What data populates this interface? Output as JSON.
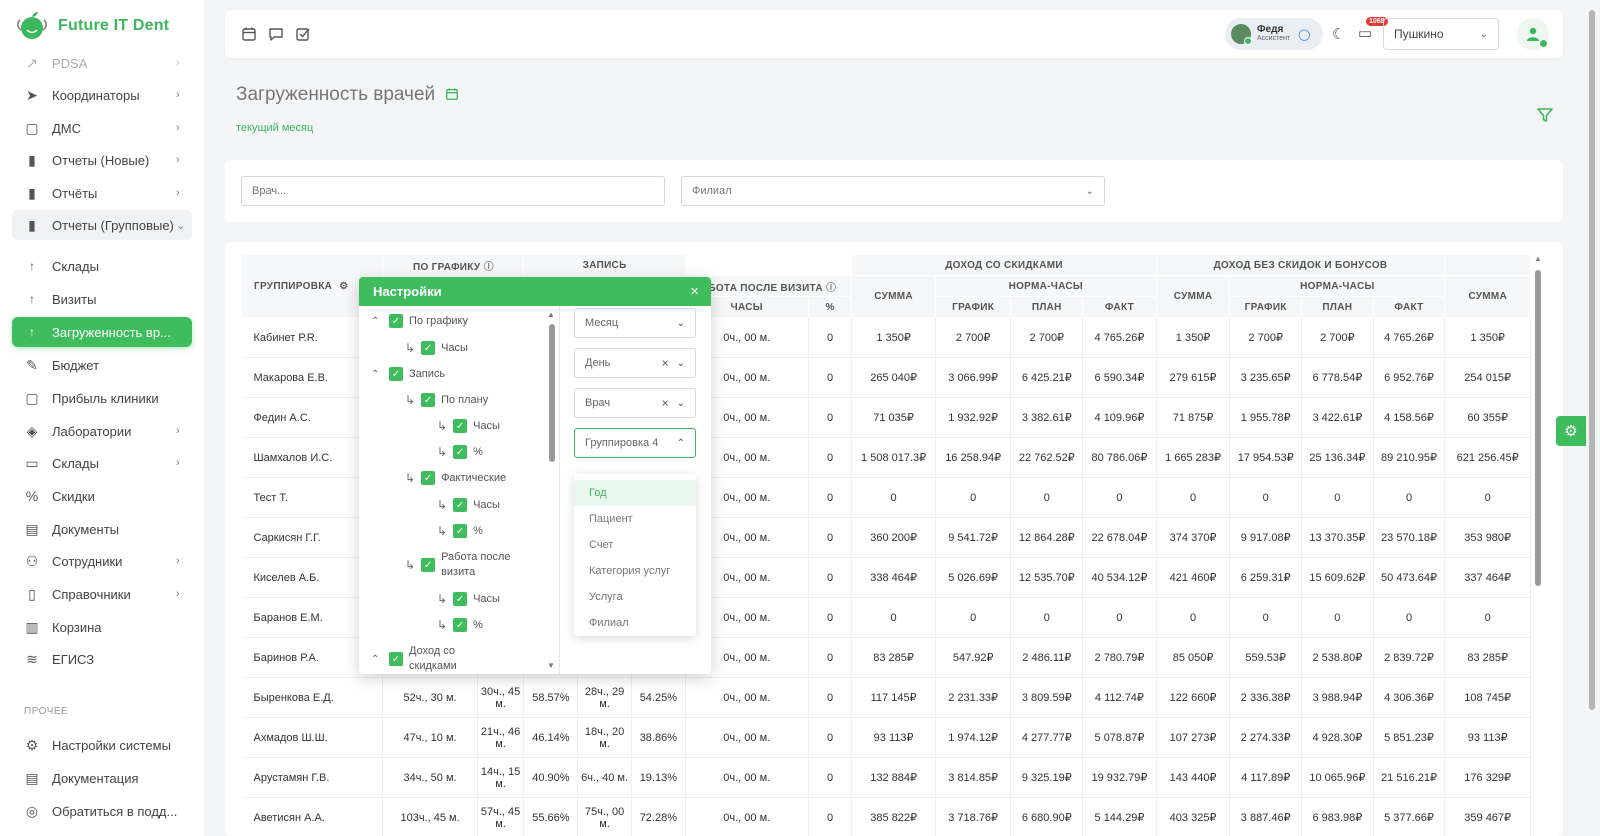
{
  "brand": {
    "name": "Future IT Dent"
  },
  "sidebar": {
    "items": [
      {
        "label": "PDSA",
        "icon": "trend-icon",
        "glyph": "↗",
        "chevron": "›"
      },
      {
        "label": "Координаторы",
        "icon": "send-icon",
        "glyph": "➤",
        "chevron": "›"
      },
      {
        "label": "ДМС",
        "icon": "clipboard-icon",
        "glyph": "▢",
        "chevron": "›"
      },
      {
        "label": "Отчеты (Новые)",
        "icon": "bar-chart-icon",
        "glyph": "▮",
        "chevron": "›"
      },
      {
        "label": "Отчёты",
        "icon": "bar-chart-icon",
        "glyph": "▮",
        "chevron": "›"
      },
      {
        "label": "Отчеты (Групповые)",
        "icon": "bar-chart-icon",
        "glyph": "▮",
        "chevron": "⌄"
      },
      {
        "label": "Склады",
        "icon": "sub-arrow-icon",
        "glyph": "↑"
      },
      {
        "label": "Визиты",
        "icon": "sub-arrow-icon",
        "glyph": "↑"
      },
      {
        "label": "Загруженность вр...",
        "icon": "sub-arrow-icon",
        "glyph": "↑"
      },
      {
        "label": "Бюджет",
        "icon": "pen-icon",
        "glyph": "✎"
      },
      {
        "label": "Прибыль клиники",
        "icon": "clipboard-icon",
        "glyph": "▢"
      },
      {
        "label": "Лаборатории",
        "icon": "layers-icon",
        "glyph": "◈",
        "chevron": "›"
      },
      {
        "label": "Склады",
        "icon": "folder-icon",
        "glyph": "▭",
        "chevron": "›"
      },
      {
        "label": "Скидки",
        "icon": "percent-icon",
        "glyph": "%"
      },
      {
        "label": "Документы",
        "icon": "document-icon",
        "glyph": "▤"
      },
      {
        "label": "Сотрудники",
        "icon": "users-icon",
        "glyph": "⚇",
        "chevron": "›"
      },
      {
        "label": "Справочники",
        "icon": "book-icon",
        "glyph": "▯",
        "chevron": "›"
      },
      {
        "label": "Корзина",
        "icon": "trash-icon",
        "glyph": "▥"
      },
      {
        "label": "ЕГИСЗ",
        "icon": "database-icon",
        "glyph": "≋"
      }
    ],
    "other_title": "ПРОЧЕЕ",
    "other_items": [
      {
        "label": "Настройки системы",
        "icon": "gear-icon",
        "glyph": "⚙"
      },
      {
        "label": "Документация",
        "icon": "document-icon",
        "glyph": "▤"
      },
      {
        "label": "Обратиться в подд...",
        "icon": "support-icon",
        "glyph": "◎"
      }
    ]
  },
  "topbar": {
    "user_name": "Федя",
    "user_role": "Ассистент",
    "notif_count": "1068",
    "branch": "Пушкино"
  },
  "page": {
    "title": "Загруженность врачей",
    "period": "текущий месяц"
  },
  "filters": {
    "doctor_placeholder": "Врач...",
    "branch_placeholder": "Филиал"
  },
  "table": {
    "groups": {
      "grouping": "ГРУППИРОВКА",
      "schedule": "ПО ГРАФИКУ",
      "appointment": "ЗАПИСЬ",
      "after_visit": "АБОТА ПОСЛЕ ВИЗИТА",
      "income_disc": "ДОХОД СО СКИДКАМИ",
      "income_nodisc": "ДОХОД БЕЗ СКИДОК И БОНУСОВ"
    },
    "sub": {
      "hours": "ЧАСЫ",
      "pct": "%",
      "sum": "СУММА",
      "norm_hours": "НОРМА-ЧАСЫ",
      "grafik": "ГРАФИК",
      "plan": "ПЛАН",
      "fact": "ФАКТ"
    },
    "rows": [
      {
        "name": "Кабинет Р.R.",
        "c1": "",
        "c2": "",
        "c3": "",
        "c4": "",
        "c5": "",
        "av_h": "0ч., 00 м.",
        "av_p": "0",
        "s1": "1 350₽",
        "g1": "2 700₽",
        "p1": "2 700₽",
        "f1": "4 765.26₽",
        "s2": "1 350₽",
        "g2": "2 700₽",
        "p2": "2 700₽",
        "f2": "4 765.26₽",
        "s3": "1 350₽"
      },
      {
        "name": "Макарова Е.В.",
        "c1": "",
        "c2": "",
        "c3": "",
        "c4": "",
        "c5": "",
        "av_h": "0ч., 00 м.",
        "av_p": "0",
        "s1": "265 040₽",
        "g1": "3 066.99₽",
        "p1": "6 425.21₽",
        "f1": "6 590.34₽",
        "s2": "279 615₽",
        "g2": "3 235.65₽",
        "p2": "6 778.54₽",
        "f2": "6 952.76₽",
        "s3": "254 015₽"
      },
      {
        "name": "Федин А.С.",
        "c1": "",
        "c2": "",
        "c3": "",
        "c4": "",
        "c5": "",
        "av_h": "0ч., 00 м.",
        "av_p": "0",
        "s1": "71 035₽",
        "g1": "1 932.92₽",
        "p1": "3 382.61₽",
        "f1": "4 109.96₽",
        "s2": "71 875₽",
        "g2": "1 955.78₽",
        "p2": "3 422.61₽",
        "f2": "4 158.56₽",
        "s3": "60 355₽"
      },
      {
        "name": "Шамхалов И.С.",
        "c1": "",
        "c2": "",
        "c3": "",
        "c4": "",
        "c5": "",
        "av_h": "0ч., 00 м.",
        "av_p": "0",
        "s1": "1 508 017.3₽",
        "g1": "16 258.94₽",
        "p1": "22 762.52₽",
        "f1": "80 786.06₽",
        "s2": "1 665 283₽",
        "g2": "17 954.53₽",
        "p2": "25 136.34₽",
        "f2": "89 210.95₽",
        "s3": "621 256.45₽"
      },
      {
        "name": "Тест Т.",
        "c1": "",
        "c2": "",
        "c3": "",
        "c4": "",
        "c5": "",
        "av_h": "0ч., 00 м.",
        "av_p": "0",
        "s1": "0",
        "g1": "0",
        "p1": "0",
        "f1": "0",
        "s2": "0",
        "g2": "0",
        "p2": "0",
        "f2": "0",
        "s3": "0"
      },
      {
        "name": "Саркисян Г.Г.",
        "c1": "",
        "c2": "",
        "c3": "",
        "c4": "",
        "c5": "",
        "av_h": "0ч., 00 м.",
        "av_p": "0",
        "s1": "360 200₽",
        "g1": "9 541.72₽",
        "p1": "12 864.28₽",
        "f1": "22 678.04₽",
        "s2": "374 370₽",
        "g2": "9 917.08₽",
        "p2": "13 370.35₽",
        "f2": "23 570.18₽",
        "s3": "353 980₽"
      },
      {
        "name": "Киселев А.Б.",
        "c1": "",
        "c2": "",
        "c3": "",
        "c4": "",
        "c5": "",
        "av_h": "0ч., 00 м.",
        "av_p": "0",
        "s1": "338 464₽",
        "g1": "5 026.69₽",
        "p1": "12 535.70₽",
        "f1": "40 534.12₽",
        "s2": "421 460₽",
        "g2": "6 259.31₽",
        "p2": "15 609.62₽",
        "f2": "50 473.64₽",
        "s3": "337 464₽"
      },
      {
        "name": "Баранов Е.М.",
        "c1": "",
        "c2": "",
        "c3": "",
        "c4": "",
        "c5": "",
        "av_h": "0ч., 00 м.",
        "av_p": "0",
        "s1": "0",
        "g1": "0",
        "p1": "0",
        "f1": "0",
        "s2": "0",
        "g2": "0",
        "p2": "0",
        "f2": "0",
        "s3": "0"
      },
      {
        "name": "Баринов Р.А.",
        "c1": "",
        "c2": "",
        "c3": "",
        "c4": "",
        "c5": "",
        "av_h": "0ч., 00 м.",
        "av_p": "0",
        "s1": "83 285₽",
        "g1": "547.92₽",
        "p1": "2 486.11₽",
        "f1": "2 780.79₽",
        "s2": "85 050₽",
        "g2": "559.53₽",
        "p2": "2 538.80₽",
        "f2": "2 839.72₽",
        "s3": "83 285₽"
      },
      {
        "name": "Быренкова Е.Д.",
        "c1": "52ч., 30 м.",
        "c2": "30ч., 45 м.",
        "c3": "58.57%",
        "c4": "28ч., 29 м.",
        "c5": "54.25%",
        "av_h": "0ч., 00 м.",
        "av_p": "0",
        "s1": "117 145₽",
        "g1": "2 231.33₽",
        "p1": "3 809.59₽",
        "f1": "4 112.74₽",
        "s2": "122 660₽",
        "g2": "2 336.38₽",
        "p2": "3 988.94₽",
        "f2": "4 306.36₽",
        "s3": "108 745₽"
      },
      {
        "name": "Ахмадов Ш.Ш.",
        "c1": "47ч., 10 м.",
        "c2": "21ч., 46 м.",
        "c3": "46.14%",
        "c4": "18ч., 20 м.",
        "c5": "38.86%",
        "av_h": "0ч., 00 м.",
        "av_p": "0",
        "s1": "93 113₽",
        "g1": "1 974.12₽",
        "p1": "4 277.77₽",
        "f1": "5 078.87₽",
        "s2": "107 273₽",
        "g2": "2 274.33₽",
        "p2": "4 928.30₽",
        "f2": "5 851.23₽",
        "s3": "93 113₽"
      },
      {
        "name": "Арустамян Г.В.",
        "c1": "34ч., 50 м.",
        "c2": "14ч., 15 м.",
        "c3": "40.90%",
        "c4": "6ч., 40 м.",
        "c5": "19.13%",
        "av_h": "0ч., 00 м.",
        "av_p": "0",
        "s1": "132 884₽",
        "g1": "3 814.85₽",
        "p1": "9 325.19₽",
        "f1": "19 932.79₽",
        "s2": "143 440₽",
        "g2": "4 117.89₽",
        "p2": "10 065.96₽",
        "f2": "21 516.21₽",
        "s3": "176 329₽"
      },
      {
        "name": "Аветисян А.А.",
        "c1": "103ч., 45 м.",
        "c2": "57ч., 45 м.",
        "c3": "55.66%",
        "c4": "75ч., 00 м.",
        "c5": "72.28%",
        "av_h": "0ч., 00 м.",
        "av_p": "0",
        "s1": "385 822₽",
        "g1": "3 718.76₽",
        "p1": "6 680.90₽",
        "f1": "5 144.29₽",
        "s2": "403 325₽",
        "g2": "3 887.46₽",
        "p2": "6 983.98₽",
        "f2": "5 377.66₽",
        "s3": "359 467₽"
      }
    ]
  },
  "settings": {
    "title": "Настройки",
    "tree": [
      {
        "label": "По графику",
        "level": 0,
        "toggle": "^"
      },
      {
        "label": "Часы",
        "level": 1
      },
      {
        "label": "Запись",
        "level": 0,
        "toggle": "^"
      },
      {
        "label": "По плану",
        "level": 1
      },
      {
        "label": "Часы",
        "level": 2
      },
      {
        "label": "%",
        "level": 2
      },
      {
        "label": "Фактические",
        "level": 1
      },
      {
        "label": "Часы",
        "level": 2
      },
      {
        "label": "%",
        "level": 2
      },
      {
        "label": "Работа после визита",
        "level": 1
      },
      {
        "label": "Часы",
        "level": 2
      },
      {
        "label": "%",
        "level": 2
      },
      {
        "label": "Доход со скидками",
        "level": 0,
        "toggle": "^"
      }
    ],
    "groupings": [
      {
        "value": "Месяц",
        "clearable": false
      },
      {
        "value": "День",
        "clearable": true
      },
      {
        "value": "Врач",
        "clearable": true
      },
      {
        "value": "Группировка 4",
        "clearable": false,
        "open": true
      }
    ],
    "options": [
      "Год",
      "Пациент",
      "Счет",
      "Категория услуг",
      "Услуга",
      "Филиал"
    ]
  }
}
